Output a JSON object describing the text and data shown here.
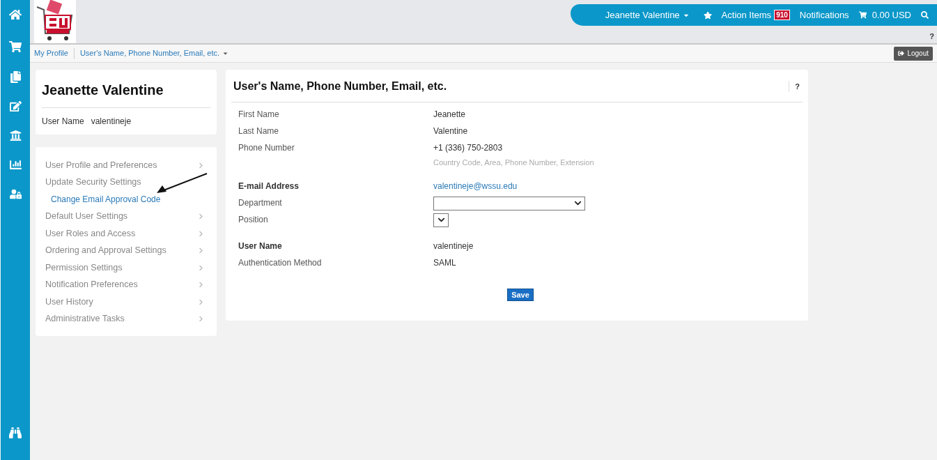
{
  "top_bar": {
    "user": "Jeanette Valentine",
    "action_items": "Action Items",
    "action_count": "910",
    "notifications": "Notifications",
    "cart_total": "0.00 USD",
    "help": "?"
  },
  "breadcrumb": [
    "My Profile",
    "User's Name, Phone Number, Email, etc."
  ],
  "logout": "Logout",
  "profile_card": {
    "name": "Jeanette Valentine",
    "username_label": "User Name",
    "username": "valentineje"
  },
  "menu": [
    {
      "label": "User Profile and Preferences"
    },
    {
      "label": "Update Security Settings",
      "children": [
        {
          "label": "Change Email Approval Code"
        }
      ]
    },
    {
      "label": "Default User Settings"
    },
    {
      "label": "User Roles and Access"
    },
    {
      "label": "Ordering and Approval Settings"
    },
    {
      "label": "Permission Settings"
    },
    {
      "label": "Notification Preferences"
    },
    {
      "label": "User History"
    },
    {
      "label": "Administrative Tasks"
    }
  ],
  "form": {
    "title": "User's Name, Phone Number, Email, etc.",
    "help": "?",
    "groups": [
      [
        {
          "label": "First Name",
          "kind": "text",
          "value": "Jeanette",
          "bold": false
        },
        {
          "label": "Last Name",
          "kind": "text",
          "value": "Valentine",
          "bold": false
        },
        {
          "label": "Phone Number",
          "kind": "text",
          "value": "+1 (336) 750-2803",
          "hint": "Country Code, Area, Phone Number, Extension",
          "bold": false
        }
      ],
      [
        {
          "label": "E-mail Address",
          "kind": "link",
          "value": "valentineje@wssu.edu",
          "bold": true
        },
        {
          "label": "Department",
          "kind": "wide-select",
          "bold": false
        },
        {
          "label": "Position",
          "kind": "small-select",
          "bold": false
        }
      ],
      [
        {
          "label": "User Name",
          "kind": "text",
          "value": "valentineje",
          "bold": true
        },
        {
          "label": "Authentication Method",
          "kind": "text",
          "value": "SAML",
          "bold": false
        }
      ]
    ],
    "save": "Save"
  }
}
